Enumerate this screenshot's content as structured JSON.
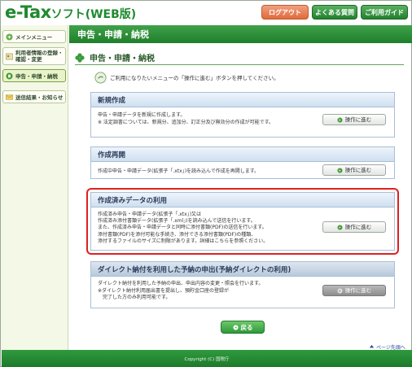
{
  "header": {
    "logo_main": "e-Tax",
    "logo_sub": "ソフト(WEB版)",
    "logout_label": "ログアウト",
    "faq_label": "よくある質問",
    "guide_label": "ご利用ガイド"
  },
  "sidebar": {
    "items": [
      {
        "label": "メインメニュー",
        "icon": "menu-icon"
      },
      {
        "label": "利用者情報の登録・確認・変更",
        "icon": "user-icon"
      },
      {
        "label": "申告・申請・納税",
        "icon": "document-icon"
      },
      {
        "label": "送信結果・お知らせ",
        "icon": "mail-icon"
      }
    ]
  },
  "main": {
    "title": "申告・申請・納税",
    "subheading": "申告・申請・納税",
    "info_text": "ご利用になりたいメニューの「操作に進む」ボタンを押してください。"
  },
  "panels": [
    {
      "title": "新規作成",
      "lines": [
        "申告・申請データを新規に作成します。",
        "※ 法定調書については、新規分、追加分、訂正分及び無効分の作成が可能です。"
      ],
      "button": "操作に進む"
    },
    {
      "title": "作成再開",
      "lines": [
        "作成中申告・申請データ(拡張子「.xtx」)を読み込んで作成を再開します。"
      ],
      "button": "操作に進む"
    },
    {
      "title": "作成済みデータの利用",
      "lines": [
        "作成済み申告・申請データ(拡張子「.xtx」)又は",
        "作成済み添付書類データ(拡張子「.xml」)を読み込んで送信を行います。",
        "また、作成済み申告・申請データと同時に添付書類(PDF)の送信を行います。",
        "添付書類(PDF)を添付可能な手続き、添付できる添付書類(PDF)の種類、",
        "添付するファイルのサイズに制限があります。詳細はこちらを参照ください。"
      ],
      "button": "操作に進む"
    },
    {
      "title": "ダイレクト納付を利用した予納の申出(予納ダイレクトの利用)",
      "lines": [
        "ダイレクト納付を利用した予納の申出、申出内容の変更・照会を行います。",
        "※ダイレクト納付利用届出書を提出し、預貯金口座の登録が",
        "　完了した方のみ利用可能です。"
      ],
      "button": "操作に進む"
    }
  ],
  "back_label": "戻る",
  "pagetop_label": "ページ先頭へ",
  "footer_text": "Copyright (C) 国税庁"
}
